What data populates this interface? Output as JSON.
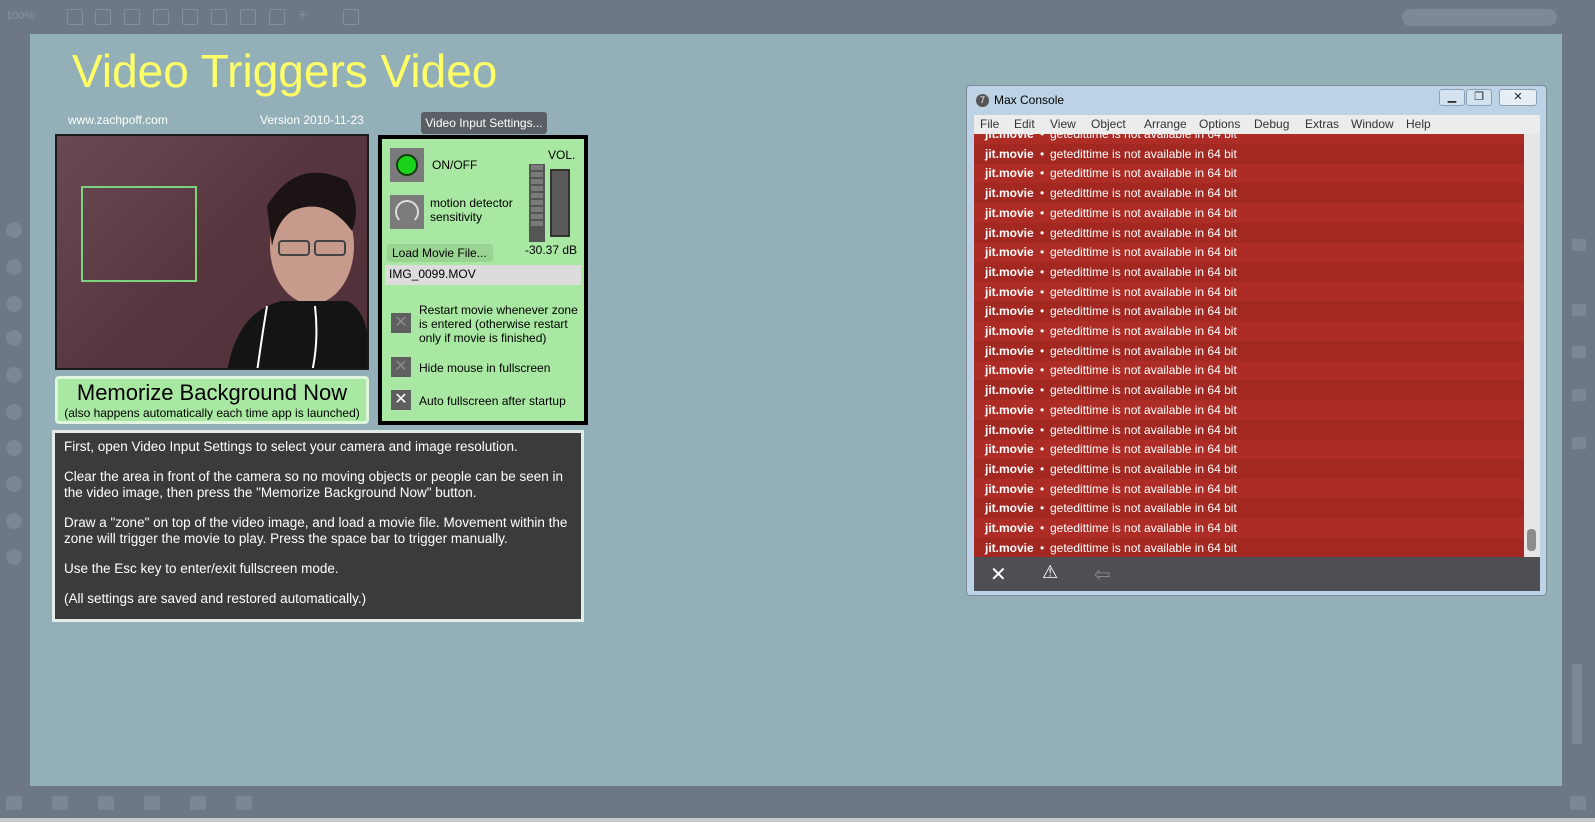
{
  "toolbar": {
    "zoom": "100%"
  },
  "patcher": {
    "title": "Video Triggers Video",
    "url": "www.zachpoff.com",
    "version": "Version 2010-11-23",
    "video_input_settings_label": "Video Input Settings...",
    "onoff_label": "ON/OFF",
    "sensitivity_label": "motion detector sensitivity",
    "vol_label": "VOL.",
    "db_readout": "-30.37 dB",
    "load_movie_label": "Load Movie File...",
    "movie_filename": "IMG_0099.MOV",
    "restart_label": "Restart movie whenever zone is entered (otherwise restart only if movie is finished)",
    "hide_mouse_label": "Hide mouse in fullscreen",
    "auto_fullscreen_label": "Auto fullscreen after startup",
    "memorize_title": "Memorize Background Now",
    "memorize_sub": "(also happens automatically each time app is launched)",
    "instructions": [
      "First, open Video Input Settings to select your camera and image resolution.",
      "Clear the area in front of the camera so no moving objects or people can be seen in the video image, then press the \"Memorize Background Now\" button.",
      "Draw a \"zone\" on top of the video image, and load a movie file.  Movement within the zone will trigger the movie to play. Press the space bar to trigger manually.",
      "Use the Esc key to enter/exit fullscreen mode.",
      "(All settings are saved and restored automatically.)"
    ],
    "colors": {
      "canvas": "#93b0b8",
      "title": "#ffff66",
      "panel": "#a9e8a2",
      "led_on": "#19d419"
    },
    "checkbox_states": {
      "restart": false,
      "hide_mouse": false,
      "auto_fullscreen": true
    }
  },
  "console": {
    "title": "Max Console",
    "window_buttons": [
      "minimize-icon",
      "restore-icon",
      "close-icon"
    ],
    "menu": [
      "File",
      "Edit",
      "View",
      "Object",
      "Arrange",
      "Options",
      "Debug",
      "Extras",
      "Window",
      "Help"
    ],
    "log": {
      "source": "jit.movie",
      "bullet": "•",
      "message": "getedittime is not available in 64 bit"
    },
    "toolbar_icons": [
      "clear-icon",
      "warning-icon",
      "back-arrow-icon"
    ]
  }
}
